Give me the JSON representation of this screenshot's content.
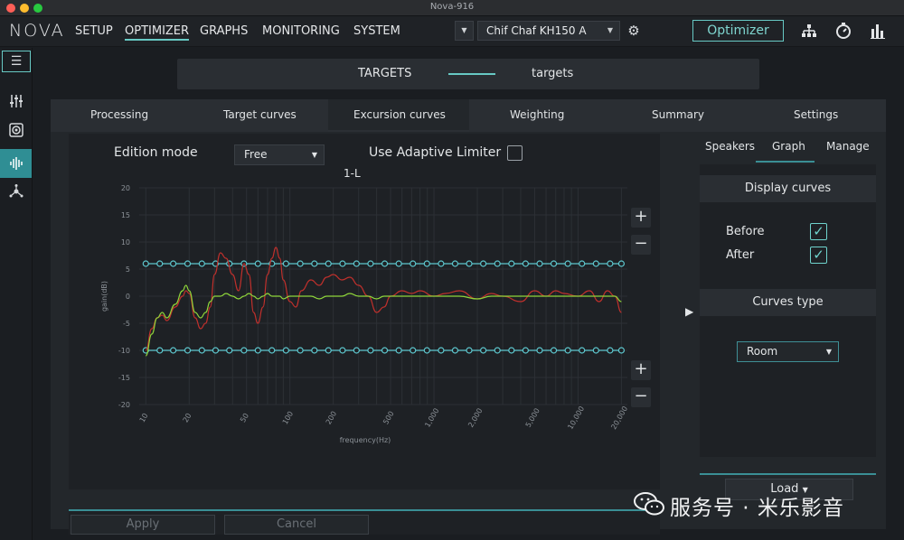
{
  "window": {
    "title": "Nova-916"
  },
  "app": {
    "logo": "NOVA"
  },
  "menu": [
    "SETUP",
    "OPTIMIZER",
    "GRAPHS",
    "MONITORING",
    "SYSTEM"
  ],
  "menu_active": "OPTIMIZER",
  "device": {
    "selected": "Chif Chaf KH150 A"
  },
  "toolbar": {
    "optimizer_label": "Optimizer",
    "icons": [
      "gear-icon",
      "hierarchy-icon",
      "stopwatch-icon",
      "bar-chart-icon"
    ]
  },
  "sidebar": {
    "icons": [
      "menu-icon",
      "sliders-icon",
      "speaker-icon",
      "waveform-icon",
      "network-icon"
    ],
    "active": "waveform-icon"
  },
  "targets": {
    "left_label": "TARGETS",
    "right_label": "targets"
  },
  "tabs": [
    "Processing",
    "Target curves",
    "Excursion curves",
    "Weighting",
    "Summary",
    "Settings"
  ],
  "tab_active": "Excursion curves",
  "editor": {
    "edition_mode_label": "Edition mode",
    "edition_mode_value": "Free",
    "adaptive_limiter_label": "Use Adaptive Limiter",
    "adaptive_limiter_checked": false,
    "plus": "+",
    "minus": "−",
    "apply_label": "Apply",
    "cancel_label": "Cancel"
  },
  "right_panel": {
    "tabs": [
      "Speakers",
      "Graph",
      "Manage"
    ],
    "tab_active": "Graph",
    "display_curves_title": "Display curves",
    "before_label": "Before",
    "before_checked": true,
    "after_label": "After",
    "after_checked": true,
    "curves_type_title": "Curves type",
    "curves_type_value": "Room",
    "load_label": "Load",
    "expand_arrow": "▶"
  },
  "watermark": {
    "text": "服务号 · 米乐影音"
  },
  "colors": {
    "accent": "#67c9c4",
    "before_curve": "#c0302c",
    "after_curve": "#8fd63a",
    "limit_curve": "#5ec8cf",
    "background": "#1a1d21"
  },
  "chart_data": {
    "type": "line",
    "title": "1-L",
    "xlabel": "frequency(Hz)",
    "ylabel": "gain(dB)",
    "xscale": "log",
    "xlim": [
      9,
      22000
    ],
    "ylim": [
      -20,
      20
    ],
    "x_ticks": [
      "10",
      "20",
      "50",
      "100",
      "200",
      "500",
      "1,000",
      "2,000",
      "5,000",
      "10,000",
      "20,000"
    ],
    "x_tick_values": [
      10,
      20,
      50,
      100,
      200,
      500,
      1000,
      2000,
      5000,
      10000,
      20000
    ],
    "y_ticks": [
      20,
      15,
      10,
      5,
      0,
      -5,
      -10,
      -15,
      -20
    ],
    "grid": true,
    "series": [
      {
        "name": "",
        "role": "upper limit",
        "x": [
          10,
          12.5,
          15.5,
          19.5,
          24.5,
          30.5,
          38,
          48,
          60,
          75,
          94,
          118,
          148,
          185,
          232,
          290,
          363,
          455,
          570,
          714,
          894,
          1120,
          1402,
          1756,
          2200,
          2756,
          3452,
          4324,
          5415,
          6782,
          8495,
          10640,
          13330,
          16690,
          20000
        ],
        "values": [
          6,
          6,
          6,
          6,
          6,
          6,
          6,
          6,
          6,
          6,
          6,
          6,
          6,
          6,
          6,
          6,
          6,
          6,
          6,
          6,
          6,
          6,
          6,
          6,
          6,
          6,
          6,
          6,
          6,
          6,
          6,
          6,
          6,
          6,
          6
        ]
      },
      {
        "name": "",
        "role": "lower limit",
        "x": [
          10,
          12.5,
          15.5,
          19.5,
          24.5,
          30.5,
          38,
          48,
          60,
          75,
          94,
          118,
          148,
          185,
          232,
          290,
          363,
          455,
          570,
          714,
          894,
          1120,
          1402,
          1756,
          2200,
          2756,
          3452,
          4324,
          5415,
          6782,
          8495,
          10640,
          13330,
          16690,
          20000
        ],
        "values": [
          -10,
          -10,
          -10,
          -10,
          -10,
          -10,
          -10,
          -10,
          -10,
          -10,
          -10,
          -10,
          -10,
          -10,
          -10,
          -10,
          -10,
          -10,
          -10,
          -10,
          -10,
          -10,
          -10,
          -10,
          -10,
          -10,
          -10,
          -10,
          -10,
          -10,
          -10,
          -10,
          -10,
          -10,
          -10
        ]
      },
      {
        "name": "",
        "role": "before",
        "x": [
          10,
          11,
          12,
          13,
          14,
          16,
          18,
          19,
          20,
          22,
          24,
          26,
          28,
          30,
          33,
          36,
          40,
          44,
          48,
          52,
          56,
          60,
          65,
          70,
          75,
          80,
          85,
          90,
          100,
          110,
          120,
          140,
          160,
          180,
          200,
          230,
          260,
          300,
          350,
          400,
          450,
          500,
          600,
          700,
          800,
          1000,
          1200,
          1500,
          2000,
          2500,
          3000,
          4000,
          5000,
          6000,
          7000,
          8000,
          10000,
          12000,
          14000,
          16000,
          18000,
          20000
        ],
        "values": [
          -10,
          -6,
          -4,
          -3.5,
          -4.5,
          -2,
          0,
          1,
          0.5,
          -4,
          -6,
          -5,
          -2,
          4,
          8,
          7,
          4,
          1,
          6,
          4,
          -3,
          -5,
          -2,
          4,
          7,
          9,
          7,
          3,
          -1,
          -2,
          1,
          3,
          2,
          3.5,
          4,
          3,
          3.5,
          2,
          0,
          -3,
          -2,
          0,
          1,
          0.5,
          1,
          0,
          0.5,
          1,
          -0.5,
          0.5,
          0,
          -1,
          1,
          0,
          1,
          0.5,
          0,
          1,
          -1,
          1,
          0,
          -3
        ]
      },
      {
        "name": "",
        "role": "after",
        "x": [
          10,
          11,
          12,
          13,
          14,
          16,
          18,
          19,
          20,
          22,
          24,
          26,
          28,
          30,
          33,
          36,
          40,
          44,
          48,
          52,
          56,
          60,
          65,
          70,
          75,
          80,
          85,
          90,
          100,
          110,
          120,
          140,
          160,
          180,
          200,
          230,
          260,
          300,
          350,
          400,
          450,
          500,
          600,
          700,
          800,
          1000,
          1200,
          1500,
          2000,
          2500,
          3000,
          4000,
          5000,
          6000,
          7000,
          8000,
          10000,
          12000,
          14000,
          16000,
          18000,
          20000
        ],
        "values": [
          -11,
          -7,
          -4,
          -3,
          -4,
          -1.5,
          1,
          2,
          1,
          -3,
          -4,
          -3,
          -1,
          0,
          0,
          0.5,
          0,
          -0.5,
          0,
          0.5,
          0,
          -0.5,
          0,
          0.5,
          0,
          0,
          0,
          -0.5,
          0,
          0,
          0,
          0,
          -0.5,
          0,
          0,
          0,
          0.5,
          0,
          0,
          -0.5,
          0,
          0,
          0,
          0,
          0,
          0,
          0,
          0,
          -0.5,
          0,
          0,
          0,
          0,
          0,
          0,
          0,
          0,
          0,
          0,
          0,
          0,
          -1
        ]
      }
    ]
  }
}
